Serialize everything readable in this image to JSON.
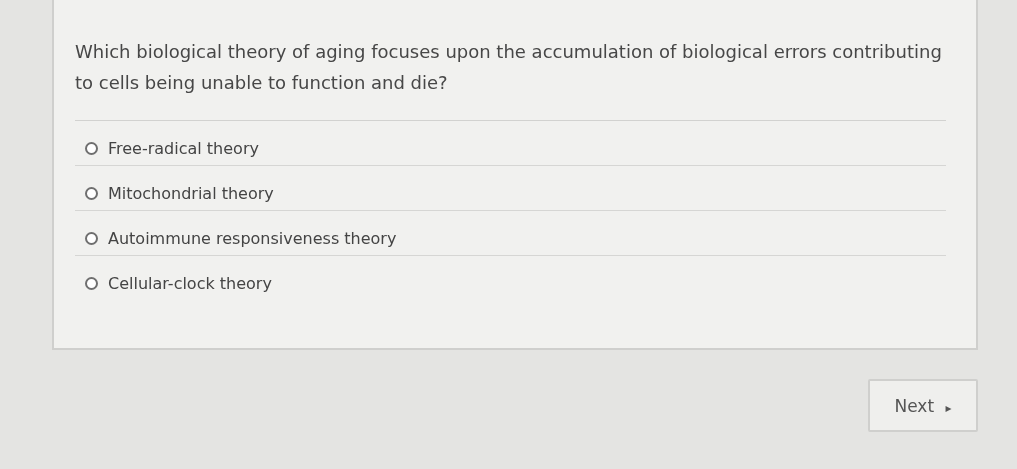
{
  "question": "Which biological theory of aging focuses upon the accumulation of biological errors contributing to cells being unable to function and die?",
  "options": [
    {
      "label": "Free-radical theory",
      "selected": false
    },
    {
      "label": "Mitochondrial theory",
      "selected": false
    },
    {
      "label": "Autoimmune responsiveness theory",
      "selected": false
    },
    {
      "label": "Cellular-clock theory",
      "selected": false
    }
  ],
  "next_button": {
    "label": "Next",
    "arrow": "▸"
  }
}
